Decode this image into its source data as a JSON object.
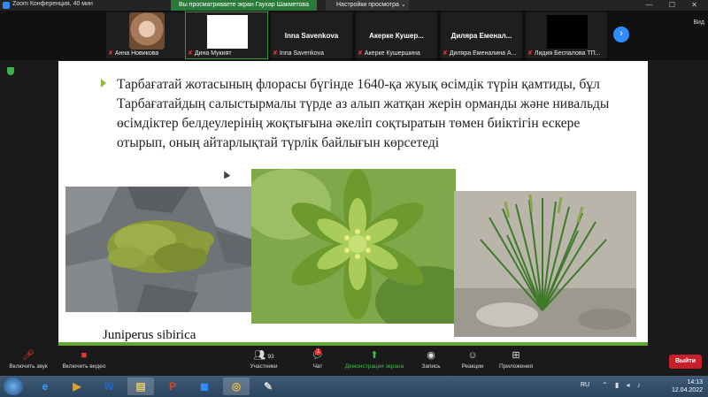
{
  "window": {
    "title": "Zoom Конференция, 40 мин",
    "share_notice": "Вы просматриваете экран Гаухар Шакметова",
    "view_options": "Настройки просмотра ⌄",
    "view_label": "Вид"
  },
  "participants": [
    {
      "name": "Анна Новикова",
      "muted": true,
      "video": "face"
    },
    {
      "name": "Дина Мукият",
      "muted": true,
      "video": "white"
    },
    {
      "name": "Inna Savenkova",
      "muted": true,
      "video": "none",
      "display": "Inna Savenkova"
    },
    {
      "name": "Акерке Кушершина",
      "muted": true,
      "video": "none",
      "display": "Акерке  Кушер..."
    },
    {
      "name": "Диляра Еменалина А...",
      "muted": true,
      "video": "none",
      "display": "Диляра  Еменал..."
    },
    {
      "name": "Лидия Беспалова ТП...",
      "muted": true,
      "video": "black"
    }
  ],
  "slide": {
    "text": "Тарбағатай жотасының флорасы бүгінде 1640-қа жуық өсімдік түрін қамтиды, бұл Тарбағатайдың салыстырмалы түрде аз алып жатқан жерін орманды және нивальды өсімдіктер белдеулерінің жоқтығына әкеліп соқтыратын төмен биіктігін ескере отырып, оның айтарлықтай түрлік байлығын көрсетеді",
    "caption": "Juniperus sibirica"
  },
  "toolbar": {
    "audio": "Включить звук",
    "video": "Включить видео",
    "participants": "Участники",
    "participants_count": "93",
    "chat": "Чат",
    "chat_badge": "1",
    "share": "Демонстрация экрана",
    "record": "Запись",
    "reactions": "Реакции",
    "apps": "Приложения",
    "exit": "Выйти"
  },
  "taskbar": {
    "lang": "RU",
    "time": "14:13",
    "date": "12.04.2022"
  },
  "colors": {
    "share_green": "#2c7a3a",
    "accent_blue": "#2d8cff",
    "exit_red": "#c8202a",
    "slide_bullet": "#8cba3a"
  }
}
